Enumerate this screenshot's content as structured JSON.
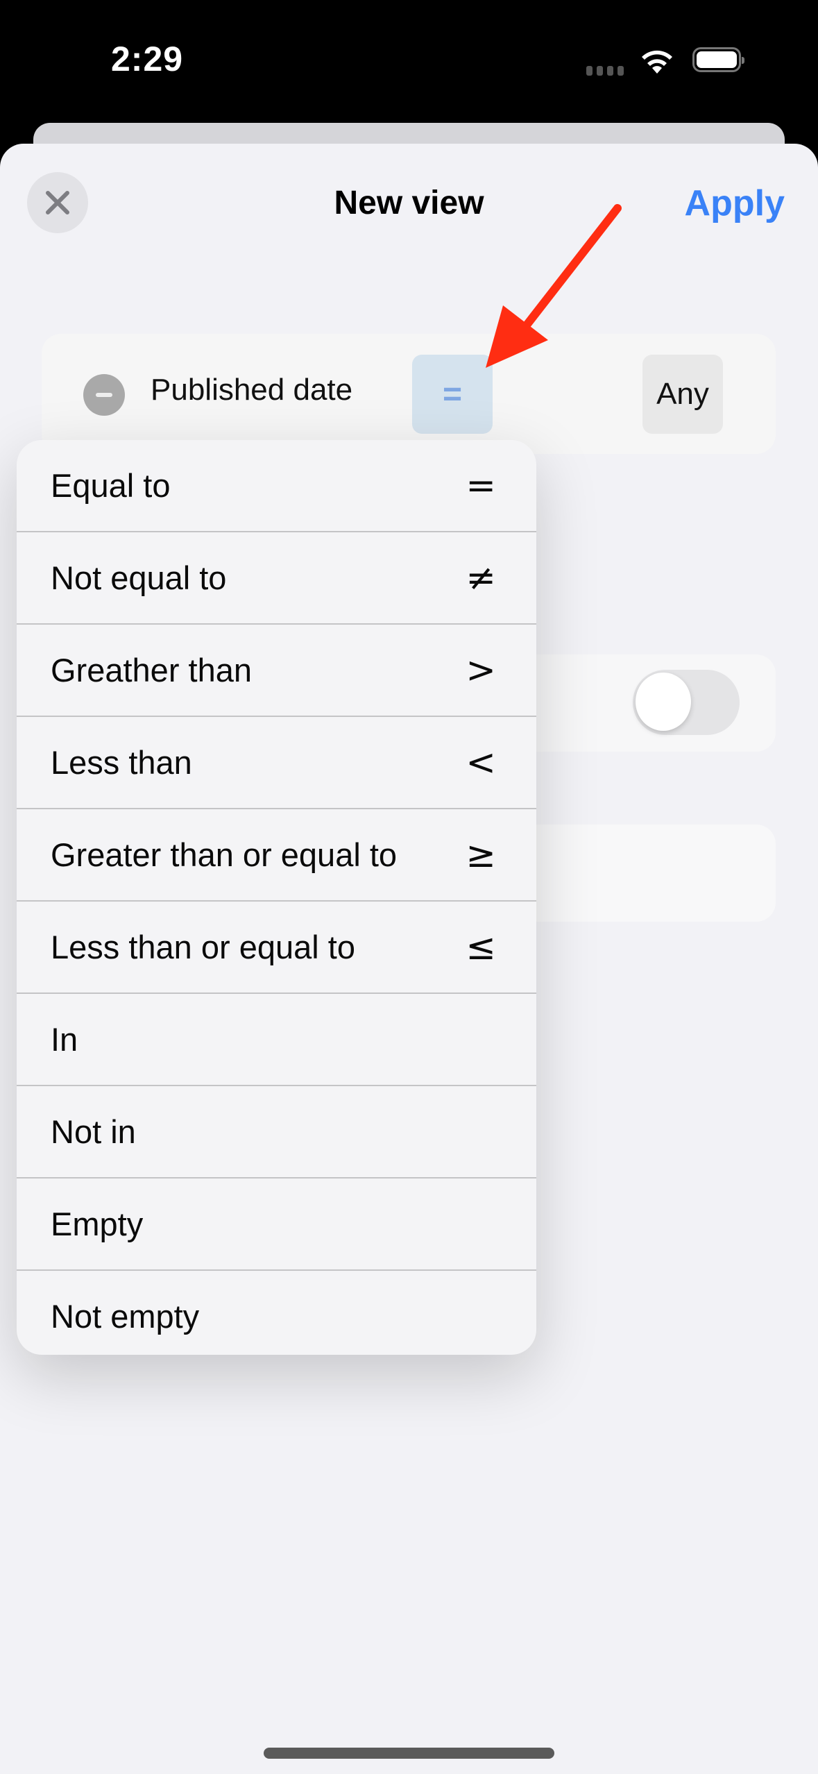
{
  "status_bar": {
    "time": "2:29",
    "wifi_icon": "wifi-icon",
    "battery_icon": "battery-icon"
  },
  "nav": {
    "title": "New view",
    "apply_label": "Apply",
    "close_icon": "close-icon"
  },
  "filter": {
    "field": "Published date",
    "operator": "=",
    "value": "Any",
    "remove_icon": "minus-circle-icon"
  },
  "toggle": {
    "on": false
  },
  "operator_menu": {
    "items": [
      {
        "label": "Equal to",
        "symbol": "="
      },
      {
        "label": "Not equal to",
        "symbol": "≠"
      },
      {
        "label": "Greather than",
        "symbol": ">"
      },
      {
        "label": "Less than",
        "symbol": "<"
      },
      {
        "label": "Greater than or equal to",
        "symbol": "≥"
      },
      {
        "label": "Less than or equal to",
        "symbol": "≤"
      },
      {
        "label": "In",
        "symbol": ""
      },
      {
        "label": "Not in",
        "symbol": ""
      },
      {
        "label": "Empty",
        "symbol": ""
      },
      {
        "label": "Not empty",
        "symbol": ""
      }
    ]
  },
  "colors": {
    "accent": "#3a82f7",
    "annotation_arrow": "#ff2d12"
  }
}
